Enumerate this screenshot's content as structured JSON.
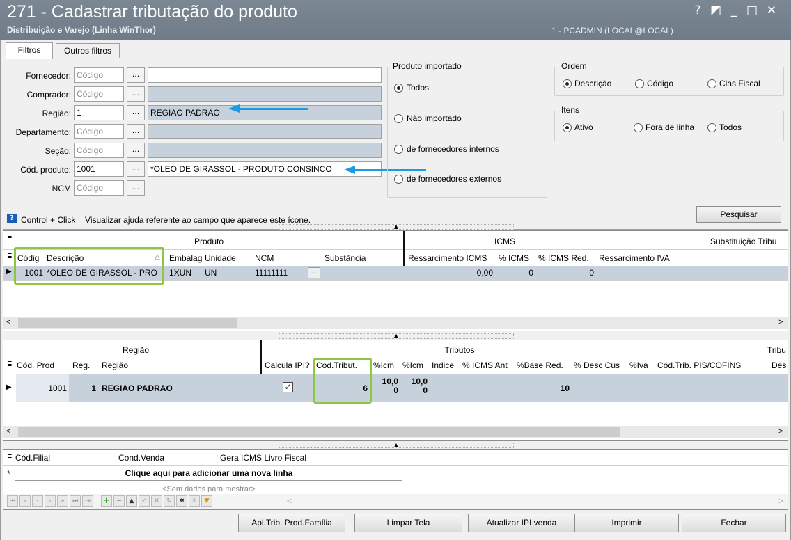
{
  "window": {
    "title": "271 - Cadastrar tributação do produto",
    "subtitle": "Distribuição e Varejo (Linha WinThor)",
    "user": "1 - PCADMIN (LOCAL@LOCAL)",
    "controls": [
      "?",
      "◩",
      "_",
      "□",
      "✕"
    ]
  },
  "tabs": [
    {
      "label": "Filtros"
    },
    {
      "label": "Outros filtros"
    }
  ],
  "filters": {
    "fornecedor": {
      "label": "Fornecedor:",
      "code": "",
      "placeholder": "Código",
      "desc": ""
    },
    "comprador": {
      "label": "Comprador:",
      "code": "",
      "placeholder": "Código",
      "desc": ""
    },
    "regiao": {
      "label": "Região:",
      "code": "1",
      "placeholder": "Código",
      "desc": "REGIAO PADRAO"
    },
    "departamento": {
      "label": "Departamento:",
      "code": "",
      "placeholder": "Código",
      "desc": ""
    },
    "secao": {
      "label": "Seção:",
      "code": "",
      "placeholder": "Código",
      "desc": ""
    },
    "cod_produto": {
      "label": "Cód. produto:",
      "code": "1001",
      "placeholder": "Código",
      "desc": "*OLEO DE GIRASSOL - PRODUTO CONSINCO"
    },
    "ncm": {
      "label": "NCM",
      "code": "",
      "placeholder": "Código"
    },
    "ellipsis": "..."
  },
  "produto_importado": {
    "title": "Produto importado",
    "options": [
      "Todos",
      "Não importado",
      "de fornecedores internos",
      "de fornecedores externos"
    ],
    "selected": 0
  },
  "ordem": {
    "title": "Ordem",
    "options": [
      "Descrição",
      "Código",
      "Clas.Fiscal"
    ],
    "selected": 0
  },
  "itens": {
    "title": "Itens",
    "options": [
      "Ativo",
      "Fora de linha",
      "Todos"
    ],
    "selected": 0
  },
  "help_text": "Control + Click = Visualizar ajuda referente ao campo que aparece este ícone.",
  "pesquisar_label": "Pesquisar",
  "grid1": {
    "bands": [
      "Produto",
      "ICMS",
      "Substituição Tribu"
    ],
    "columns": [
      "Códig",
      "Descrição",
      "Embalag",
      "Unidade",
      "NCM",
      "Substância",
      "Ressarcimento ICMS",
      "% ICMS",
      "% ICMS Red.",
      "Ressarcimento IVA"
    ],
    "rows": [
      [
        "1001",
        "*OLEO DE GIRASSOL - PRO",
        "1XUN",
        "UN",
        "11111111",
        "",
        "0,00",
        "0",
        "0",
        ""
      ]
    ]
  },
  "grid2": {
    "bands": [
      "Região",
      "Tributos",
      "Tribu"
    ],
    "columns": [
      "Cód. Prod",
      "Reg.",
      "Região",
      "Calcula IPI?",
      "Cod.Tribut.",
      "%Icm",
      "%Icm",
      "Indice",
      "% ICMS Ant",
      "%Base Red.",
      "% Desc Cus",
      "%Iva",
      "Cód.Trib. PIS/COFINS",
      "Des"
    ],
    "rows": [
      [
        "1001",
        "1",
        "REGIAO PADRAO",
        "",
        "6",
        "10,0\n0",
        "10,0\n0",
        "",
        "",
        "10",
        "",
        "",
        "",
        ""
      ]
    ]
  },
  "grid3": {
    "columns": [
      "Cód.Filial",
      "Cond.Venda",
      "Gera ICMS Livro Fiscal"
    ],
    "new_row": "Clique aqui para adicionar uma nova linha",
    "empty": "<Sem dados para mostrar>"
  },
  "footer_buttons": [
    "Apl.Trib. Prod.Família",
    "Limpar Tela",
    "Atualizar IPI venda",
    "Imprimir",
    "Fechar"
  ],
  "colors": {
    "titlebar": "#7b8894",
    "readonly": "#c7d1dc",
    "selected_row": "#c7d1dc",
    "highlight": "#8dc63f",
    "arrow": "#1e9be0"
  }
}
